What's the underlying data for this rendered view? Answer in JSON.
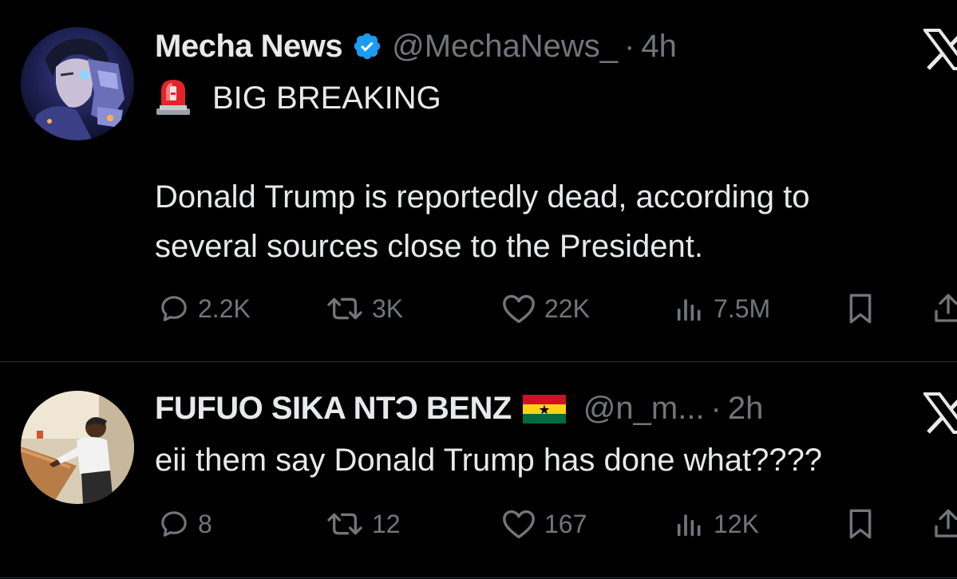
{
  "tweets": [
    {
      "display_name": "Mecha News",
      "verified": true,
      "handle": "@MechaNews_",
      "separator": "·",
      "time": "4h",
      "text_lines": [
        "BIG BREAKING",
        "",
        "Donald Trump is reportedly dead, according to",
        "several sources close to the President."
      ],
      "leading_emoji_icon": "rotating-light-siren-icon",
      "avatar_icon": "mecha-robot-avatar",
      "stats": {
        "replies": "2.2K",
        "reposts": "3K",
        "likes": "22K",
        "views": "7.5M"
      }
    },
    {
      "display_name": "FUFUO SIKA NTƆ BENZ",
      "verified": false,
      "flag_icon": "ghana-flag-icon",
      "handle": "@n_m...",
      "separator": "·",
      "time": "2h",
      "text_lines": [
        "eii them say Donald Trump has done what????"
      ],
      "avatar_icon": "person-photo-avatar",
      "stats": {
        "replies": "8",
        "reposts": "12",
        "likes": "167",
        "views": "12K"
      }
    }
  ],
  "colors": {
    "background": "#000000",
    "text_primary": "#e7e9ea",
    "text_secondary": "#71767b",
    "verified_blue": "#1d9bf0",
    "divider": "#2f3336"
  }
}
